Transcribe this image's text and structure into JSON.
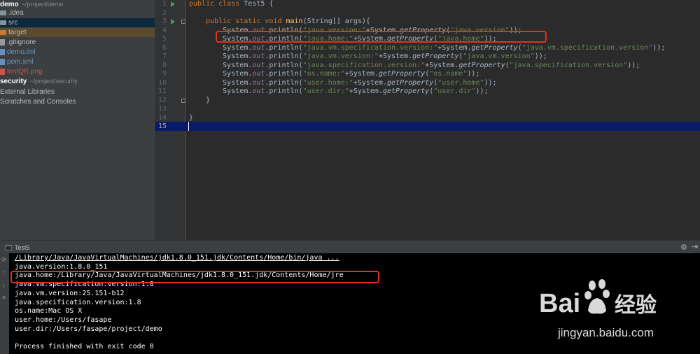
{
  "project_tree": [
    {
      "name": "demo",
      "path": "~/project/demo",
      "type": "module",
      "bold": true
    },
    {
      "name": ".idea",
      "type": "folder",
      "indent": 1
    },
    {
      "name": "src",
      "type": "folder",
      "indent": 1,
      "selected": true
    },
    {
      "name": "target",
      "type": "folder-excluded",
      "indent": 1
    },
    {
      "name": ".gitignore",
      "type": "file",
      "indent": 1
    },
    {
      "name": "demo.iml",
      "type": "file-iml",
      "indent": 1
    },
    {
      "name": "pom.xml",
      "type": "file-maven",
      "indent": 1
    },
    {
      "name": "testQR.png",
      "type": "file-png",
      "indent": 1
    },
    {
      "name": "security",
      "path": "~/project/security",
      "type": "module",
      "bold": true
    },
    {
      "name": "External Libraries",
      "type": "libraries",
      "indent": 0
    },
    {
      "name": "Scratches and Consoles",
      "type": "scratches",
      "indent": 0
    }
  ],
  "editor": {
    "current_line": "15",
    "line_numbers": [
      "1",
      "2",
      "3",
      "4",
      "5",
      "6",
      "7",
      "8",
      "9",
      "10",
      "11",
      "12",
      "13",
      "14",
      "15"
    ],
    "lines": [
      [
        {
          "t": "public class ",
          "c": "kw"
        },
        {
          "t": "Test5 {",
          "c": ""
        }
      ],
      [
        {
          "t": "",
          "c": ""
        }
      ],
      [
        {
          "t": "    ",
          "c": ""
        },
        {
          "t": "public static void ",
          "c": "kw"
        },
        {
          "t": "main",
          "c": "fn"
        },
        {
          "t": "(String[] args){",
          "c": ""
        }
      ],
      [
        {
          "t": "        System.",
          "c": ""
        },
        {
          "t": "out",
          "c": "fld"
        },
        {
          "t": ".println(",
          "c": ""
        },
        {
          "t": "\"java.version:\"",
          "c": "st"
        },
        {
          "t": "+System.",
          "c": ""
        },
        {
          "t": "getProperty",
          "c": "ital"
        },
        {
          "t": "(",
          "c": ""
        },
        {
          "t": "\"java.version\"",
          "c": "st"
        },
        {
          "t": "));",
          "c": ""
        }
      ],
      [
        {
          "t": "        System.",
          "c": ""
        },
        {
          "t": "out",
          "c": "fld"
        },
        {
          "t": ".println(",
          "c": ""
        },
        {
          "t": "\"java.home:\"",
          "c": "st"
        },
        {
          "t": "+System.",
          "c": ""
        },
        {
          "t": "getProperty",
          "c": "ital"
        },
        {
          "t": "(",
          "c": ""
        },
        {
          "t": "\"java.home\"",
          "c": "st"
        },
        {
          "t": "));",
          "c": ""
        }
      ],
      [
        {
          "t": "        System.",
          "c": ""
        },
        {
          "t": "out",
          "c": "fld"
        },
        {
          "t": ".println(",
          "c": ""
        },
        {
          "t": "\"java.vm.specification.version:\"",
          "c": "st"
        },
        {
          "t": "+System.",
          "c": ""
        },
        {
          "t": "getProperty",
          "c": "ital"
        },
        {
          "t": "(",
          "c": ""
        },
        {
          "t": "\"java.vm.specification.version\"",
          "c": "st"
        },
        {
          "t": "));",
          "c": ""
        }
      ],
      [
        {
          "t": "        System.",
          "c": ""
        },
        {
          "t": "out",
          "c": "fld"
        },
        {
          "t": ".println(",
          "c": ""
        },
        {
          "t": "\"java.vm.version:\"",
          "c": "st"
        },
        {
          "t": "+System.",
          "c": ""
        },
        {
          "t": "getProperty",
          "c": "ital"
        },
        {
          "t": "(",
          "c": ""
        },
        {
          "t": "\"java.vm.version\"",
          "c": "st"
        },
        {
          "t": "));",
          "c": ""
        }
      ],
      [
        {
          "t": "        System.",
          "c": ""
        },
        {
          "t": "out",
          "c": "fld"
        },
        {
          "t": ".println(",
          "c": ""
        },
        {
          "t": "\"java.specification.version:\"",
          "c": "st"
        },
        {
          "t": "+System.",
          "c": ""
        },
        {
          "t": "getProperty",
          "c": "ital"
        },
        {
          "t": "(",
          "c": ""
        },
        {
          "t": "\"java.specification.version\"",
          "c": "st"
        },
        {
          "t": "));",
          "c": ""
        }
      ],
      [
        {
          "t": "        System.",
          "c": ""
        },
        {
          "t": "out",
          "c": "fld"
        },
        {
          "t": ".println(",
          "c": ""
        },
        {
          "t": "\"os.name:\"",
          "c": "st"
        },
        {
          "t": "+System.",
          "c": ""
        },
        {
          "t": "getProperty",
          "c": "ital"
        },
        {
          "t": "(",
          "c": ""
        },
        {
          "t": "\"os.name\"",
          "c": "st"
        },
        {
          "t": "));",
          "c": ""
        }
      ],
      [
        {
          "t": "        System.",
          "c": ""
        },
        {
          "t": "out",
          "c": "fld"
        },
        {
          "t": ".println(",
          "c": ""
        },
        {
          "t": "\"user.home:\"",
          "c": "st"
        },
        {
          "t": "+System.",
          "c": ""
        },
        {
          "t": "getProperty",
          "c": "ital"
        },
        {
          "t": "(",
          "c": ""
        },
        {
          "t": "\"user.home\"",
          "c": "st"
        },
        {
          "t": "));",
          "c": ""
        }
      ],
      [
        {
          "t": "        System.",
          "c": ""
        },
        {
          "t": "out",
          "c": "fld"
        },
        {
          "t": ".println(",
          "c": ""
        },
        {
          "t": "\"user.dir:\"",
          "c": "st"
        },
        {
          "t": "+System.",
          "c": ""
        },
        {
          "t": "getProperty",
          "c": "ital"
        },
        {
          "t": "(",
          "c": ""
        },
        {
          "t": "\"user.dir\"",
          "c": "st"
        },
        {
          "t": "));",
          "c": ""
        }
      ],
      [
        {
          "t": "    }",
          "c": ""
        }
      ],
      [
        {
          "t": "",
          "c": ""
        }
      ],
      [
        {
          "t": "}",
          "c": ""
        }
      ],
      [
        {
          "t": "",
          "c": ""
        }
      ]
    ]
  },
  "run_panel": {
    "tab_label": "Test5",
    "output": [
      "/Library/Java/JavaVirtualMachines/jdk1.8.0_151.jdk/Contents/Home/bin/java ...",
      "java.version:1.8.0_151",
      "java.home:/Library/Java/JavaVirtualMachines/jdk1.8.0_151.jdk/Contents/Home/jre",
      "java.vm.specification.version:1.8",
      "java.vm.version:25.151-b12",
      "java.specification.version:1.8",
      "os.name:Mac OS X",
      "user.home:/Users/fasape",
      "user.dir:/Users/fasape/project/demo",
      "",
      "Process finished with exit code 0"
    ]
  },
  "watermark": {
    "brand": "Bai",
    "brand2": "经验",
    "url": "jingyan.baidu.com"
  },
  "colors": {
    "highlight_box": "#e0321d",
    "current_line": "#0a1a6a",
    "keyword": "#cc7832",
    "string": "#6a8759"
  }
}
